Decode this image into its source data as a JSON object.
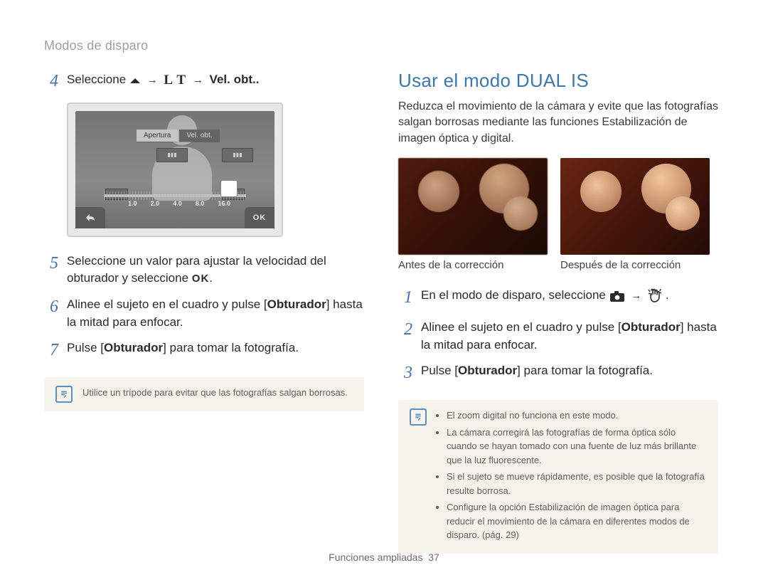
{
  "breadcrumb": "Modos de disparo",
  "left": {
    "step4_prefix": "Seleccione ",
    "step4_suffix": " Vel. obt..",
    "device": {
      "tab1": "Apertura",
      "tab2": "Vel. obt.",
      "ticks": [
        "1.0",
        "2.0",
        "4.0",
        "8.0",
        "16.0"
      ],
      "ok": "OK"
    },
    "step5_a": "Seleccione un valor para ajustar la velocidad del obturador y seleccione ",
    "step5_ok": "OK",
    "step5_b": ".",
    "step6_a": "Alinee el sujeto en el cuadro y pulse [",
    "step6_bold": "Obturador",
    "step6_b": "] hasta la mitad para enfocar.",
    "step7_a": "Pulse [",
    "step7_bold": "Obturador",
    "step7_b": "] para tomar la fotografía.",
    "note": "Utilice un trípode para evitar que las fotografías salgan borrosas."
  },
  "right": {
    "h2": "Usar el modo DUAL IS",
    "lead": "Reduzca el movimiento de la cámara y evite que las fotografías salgan borrosas mediante las funciones Estabilización de imagen óptica y digital.",
    "cap_before": "Antes de la corrección",
    "cap_after": "Después de la corrección",
    "step1_a": "En el modo de disparo, seleccione ",
    "step1_b": " .",
    "step2_a": "Alinee el sujeto en el cuadro y pulse [",
    "step2_bold": "Obturador",
    "step2_b": "] hasta la mitad para enfocar.",
    "step3_a": "Pulse [",
    "step3_bold": "Obturador",
    "step3_b": "] para tomar la fotografía.",
    "notes": [
      "El zoom digital no funciona en este modo.",
      "La cámara corregirá las fotografías de forma óptica sólo cuando se hayan tomado con una fuente de luz más brillante que la luz fluorescente.",
      "Si el sujeto se mueve rápidamente, es posible que la fotografía resulte borrosa.",
      "Configure la opción Estabilización de imagen óptica para reducir el movimiento de la cámara en diferentes modos de disparo. (pág. 29)"
    ]
  },
  "footer_label": "Funciones ampliadas",
  "footer_page": "37"
}
